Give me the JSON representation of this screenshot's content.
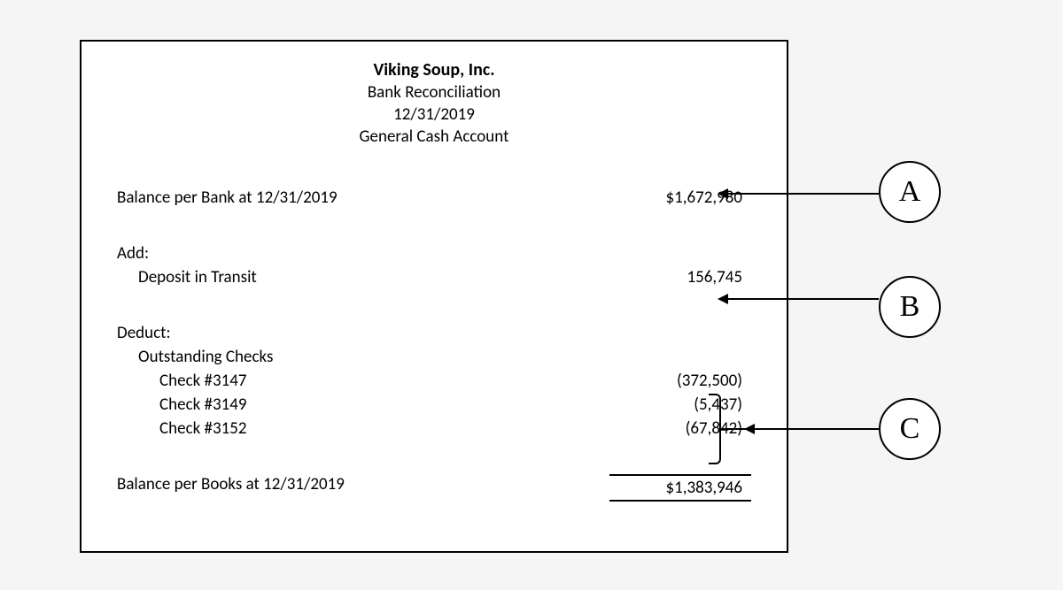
{
  "header": {
    "company": "Viking Soup, Inc.",
    "statement": "Bank Reconciliation",
    "date": "12/31/2019",
    "account": "General Cash Account"
  },
  "balance_bank": {
    "label": "Balance per Bank at 12/31/2019",
    "amount": "$1,672,980"
  },
  "add": {
    "label": "Add:",
    "items": [
      {
        "label": "Deposit in Transit",
        "amount": "156,745"
      }
    ]
  },
  "deduct": {
    "label": "Deduct:",
    "subhead": "Outstanding Checks",
    "items": [
      {
        "label": "Check #3147",
        "amount": "(372,500)"
      },
      {
        "label": "Check #3149",
        "amount": "(5,437)"
      },
      {
        "label": "Check #3152",
        "amount": "(67,842)"
      }
    ]
  },
  "balance_books": {
    "label": "Balance per Books at 12/31/2019",
    "amount": "$1,383,946"
  },
  "callouts": {
    "a": "A",
    "b": "B",
    "c": "C"
  }
}
